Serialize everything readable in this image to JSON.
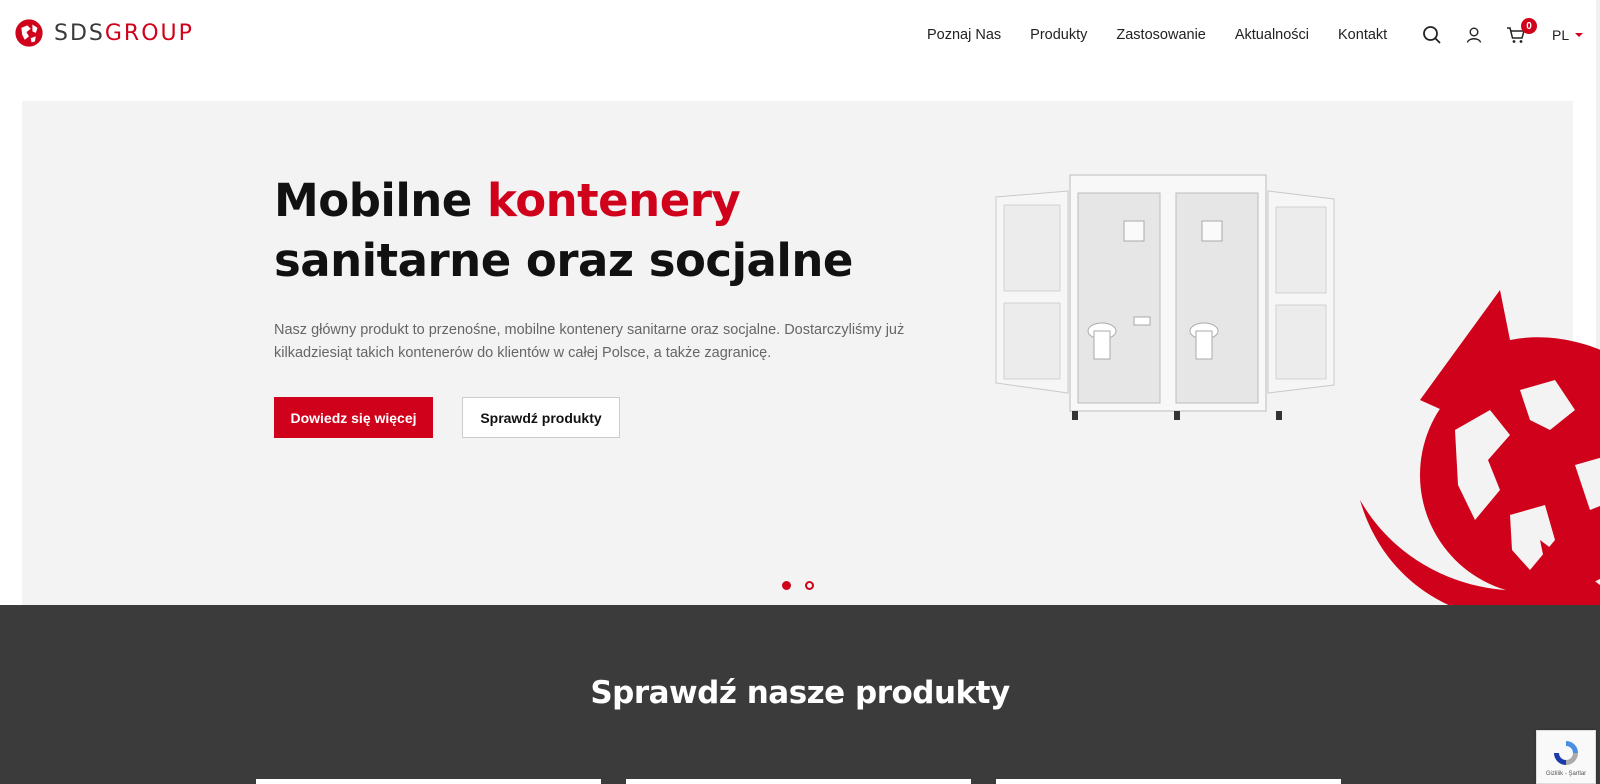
{
  "brand": {
    "part1": "SDS",
    "part2": "GROUP"
  },
  "nav": {
    "items": [
      "Poznaj Nas",
      "Produkty",
      "Zastosowanie",
      "Aktualności",
      "Kontakt"
    ]
  },
  "header": {
    "cart_count": "0",
    "language": "PL"
  },
  "hero": {
    "title_part1": "Mobilne ",
    "title_accent": "kontenery",
    "title_part2": " sanitarne oraz socjalne",
    "description": "Nasz główny produkt to przenośne, mobilne kontenery sanitarne oraz socjalne. Dostarczyliśmy już kilkadziesiąt takich kontenerów do klientów w całej Polsce, a także zagranicę.",
    "primary_button": "Dowiedz się więcej",
    "secondary_button": "Sprawdź produkty",
    "slide_count": 2,
    "active_slide": 1
  },
  "products_section": {
    "title": "Sprawdź nasze produkty"
  },
  "recaptcha": {
    "label": "Gizlilik - Şartlar"
  },
  "colors": {
    "accent": "#d0021b",
    "dark": "#3b3b3b",
    "hero_bg": "#f3f3f3"
  }
}
